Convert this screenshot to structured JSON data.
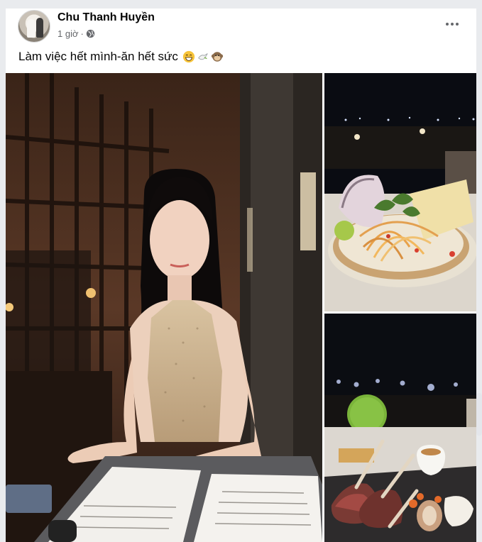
{
  "post": {
    "author": "Chu Thanh Huyền",
    "time": "1 giờ",
    "separator": "·",
    "audience_icon": "globe-icon",
    "caption": "Làm việc hết mình-ăn hết sức",
    "caption_emojis": [
      "grinning-face-icon",
      "dove-icon",
      "monkey-face-icon"
    ],
    "more_icon": "more-options-icon"
  },
  "photos": [
    {
      "subject": "woman-dining-photo"
    },
    {
      "subject": "papaya-salad-photo"
    },
    {
      "subject": "lamb-chops-photo"
    }
  ]
}
